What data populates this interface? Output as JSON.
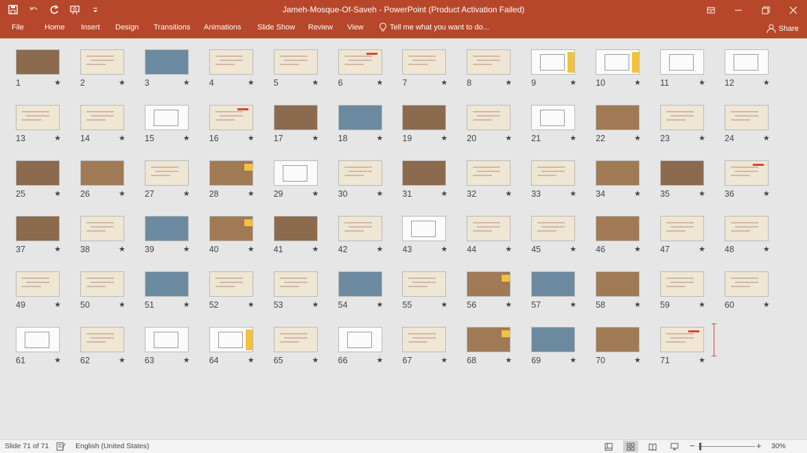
{
  "window": {
    "title": "Jameh-Mosque-Of-Saveh - PowerPoint (Product Activation Failed)"
  },
  "qat": {
    "icons": [
      "save-icon",
      "undo-icon",
      "redo-icon",
      "slideshow-from-start-icon",
      "customize-qat-icon"
    ]
  },
  "ribbon": {
    "tabs": [
      "File",
      "Home",
      "Insert",
      "Design",
      "Transitions",
      "Animations",
      "Slide Show",
      "Review",
      "View"
    ],
    "tell_me": "Tell me what you want to do...",
    "share": "Share"
  },
  "colors": {
    "brand": "#b7472a",
    "slide_background": "#efe6d4",
    "accent_yellow": "#f3c23a",
    "accent_red": "#d9432b"
  },
  "slides": [
    {
      "n": "1",
      "star": "★"
    },
    {
      "n": "2",
      "star": "★"
    },
    {
      "n": "3",
      "star": "★"
    },
    {
      "n": "4",
      "star": "★"
    },
    {
      "n": "5",
      "star": "★"
    },
    {
      "n": "6",
      "star": "★"
    },
    {
      "n": "7",
      "star": "★"
    },
    {
      "n": "8",
      "star": "★"
    },
    {
      "n": "9",
      "star": "★"
    },
    {
      "n": "10",
      "star": "★"
    },
    {
      "n": "11",
      "star": "★"
    },
    {
      "n": "12",
      "star": "★"
    },
    {
      "n": "13",
      "star": "★"
    },
    {
      "n": "14",
      "star": "★"
    },
    {
      "n": "15",
      "star": "★"
    },
    {
      "n": "16",
      "star": "★"
    },
    {
      "n": "17",
      "star": "★"
    },
    {
      "n": "18",
      "star": "★"
    },
    {
      "n": "19",
      "star": "★"
    },
    {
      "n": "20",
      "star": "★"
    },
    {
      "n": "21",
      "star": "★"
    },
    {
      "n": "22",
      "star": "★"
    },
    {
      "n": "23",
      "star": "★"
    },
    {
      "n": "24",
      "star": "★"
    },
    {
      "n": "25",
      "star": "★"
    },
    {
      "n": "26",
      "star": "★"
    },
    {
      "n": "27",
      "star": "★"
    },
    {
      "n": "28",
      "star": "★"
    },
    {
      "n": "29",
      "star": "★"
    },
    {
      "n": "30",
      "star": "★"
    },
    {
      "n": "31",
      "star": "★"
    },
    {
      "n": "32",
      "star": "★"
    },
    {
      "n": "33",
      "star": "★"
    },
    {
      "n": "34",
      "star": "★"
    },
    {
      "n": "35",
      "star": "★"
    },
    {
      "n": "36",
      "star": "★"
    },
    {
      "n": "37",
      "star": "★"
    },
    {
      "n": "38",
      "star": "★"
    },
    {
      "n": "39",
      "star": "★"
    },
    {
      "n": "40",
      "star": "★"
    },
    {
      "n": "41",
      "star": "★"
    },
    {
      "n": "42",
      "star": "★"
    },
    {
      "n": "43",
      "star": "★"
    },
    {
      "n": "44",
      "star": "★"
    },
    {
      "n": "45",
      "star": "★"
    },
    {
      "n": "46",
      "star": "★"
    },
    {
      "n": "47",
      "star": "★"
    },
    {
      "n": "48",
      "star": "★"
    },
    {
      "n": "49",
      "star": "★"
    },
    {
      "n": "50",
      "star": "★"
    },
    {
      "n": "51",
      "star": "★"
    },
    {
      "n": "52",
      "star": "★"
    },
    {
      "n": "53",
      "star": "★"
    },
    {
      "n": "54",
      "star": "★"
    },
    {
      "n": "55",
      "star": "★"
    },
    {
      "n": "56",
      "star": "★"
    },
    {
      "n": "57",
      "star": "★"
    },
    {
      "n": "58",
      "star": "★"
    },
    {
      "n": "59",
      "star": "★"
    },
    {
      "n": "60",
      "star": "★"
    },
    {
      "n": "61",
      "star": "★"
    },
    {
      "n": "62",
      "star": "★"
    },
    {
      "n": "63",
      "star": "★"
    },
    {
      "n": "64",
      "star": "★"
    },
    {
      "n": "65",
      "star": "★"
    },
    {
      "n": "66",
      "star": "★"
    },
    {
      "n": "67",
      "star": "★"
    },
    {
      "n": "68",
      "star": "★"
    },
    {
      "n": "69",
      "star": "★"
    },
    {
      "n": "70",
      "star": "★"
    },
    {
      "n": "71",
      "star": "★"
    }
  ],
  "status": {
    "slide_indicator": "Slide 71 of 71",
    "language": "English (United States)",
    "zoom_minus": "−",
    "zoom_plus": "+",
    "zoom_level": "30%"
  }
}
